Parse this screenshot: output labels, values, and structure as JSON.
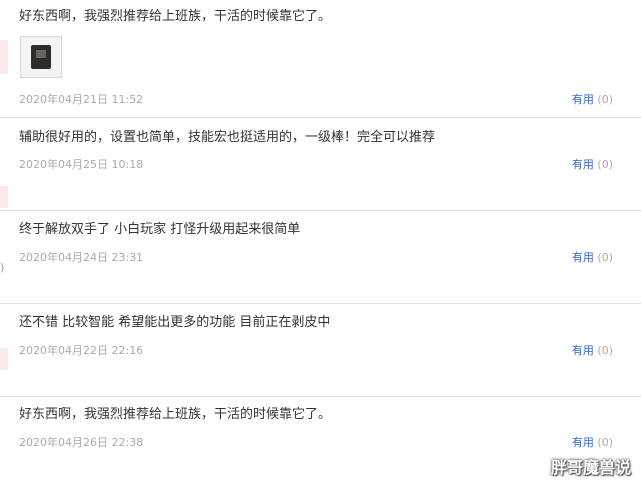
{
  "reviews": [
    {
      "text": "好东西啊，我强烈推荐给上班族，干活的时候靠它了。",
      "date": "2020年04月21日 11:52",
      "helpful_label": "有用",
      "helpful_count": "(0)",
      "has_image": true
    },
    {
      "text": "辅助很好用的，设置也简单，技能宏也挺适用的，一级棒！完全可以推荐",
      "date": "2020年04月25日 10:18",
      "helpful_label": "有用",
      "helpful_count": "(0)"
    },
    {
      "text": "终于解放双手了 小白玩家 打怪升级用起来很简单",
      "date": "2020年04月24日 23:31",
      "helpful_label": "有用",
      "helpful_count": "(0)"
    },
    {
      "text": "还不错 比较智能 希望能出更多的功能 目前正在剥皮中",
      "date": "2020年04月22日 22:16",
      "helpful_label": "有用",
      "helpful_count": "(0)"
    },
    {
      "text": "好东西啊，我强烈推荐给上班族，干活的时候靠它了。",
      "date": "2020年04月26日 22:38",
      "helpful_label": "有用",
      "helpful_count": "(0)"
    }
  ],
  "edge_glyph": ")",
  "watermark": "胖哥魔兽说",
  "colors": {
    "text": "#333333",
    "date": "#aaaaaa",
    "helpful_link": "#3366cc",
    "divider": "#e2e2e2"
  }
}
